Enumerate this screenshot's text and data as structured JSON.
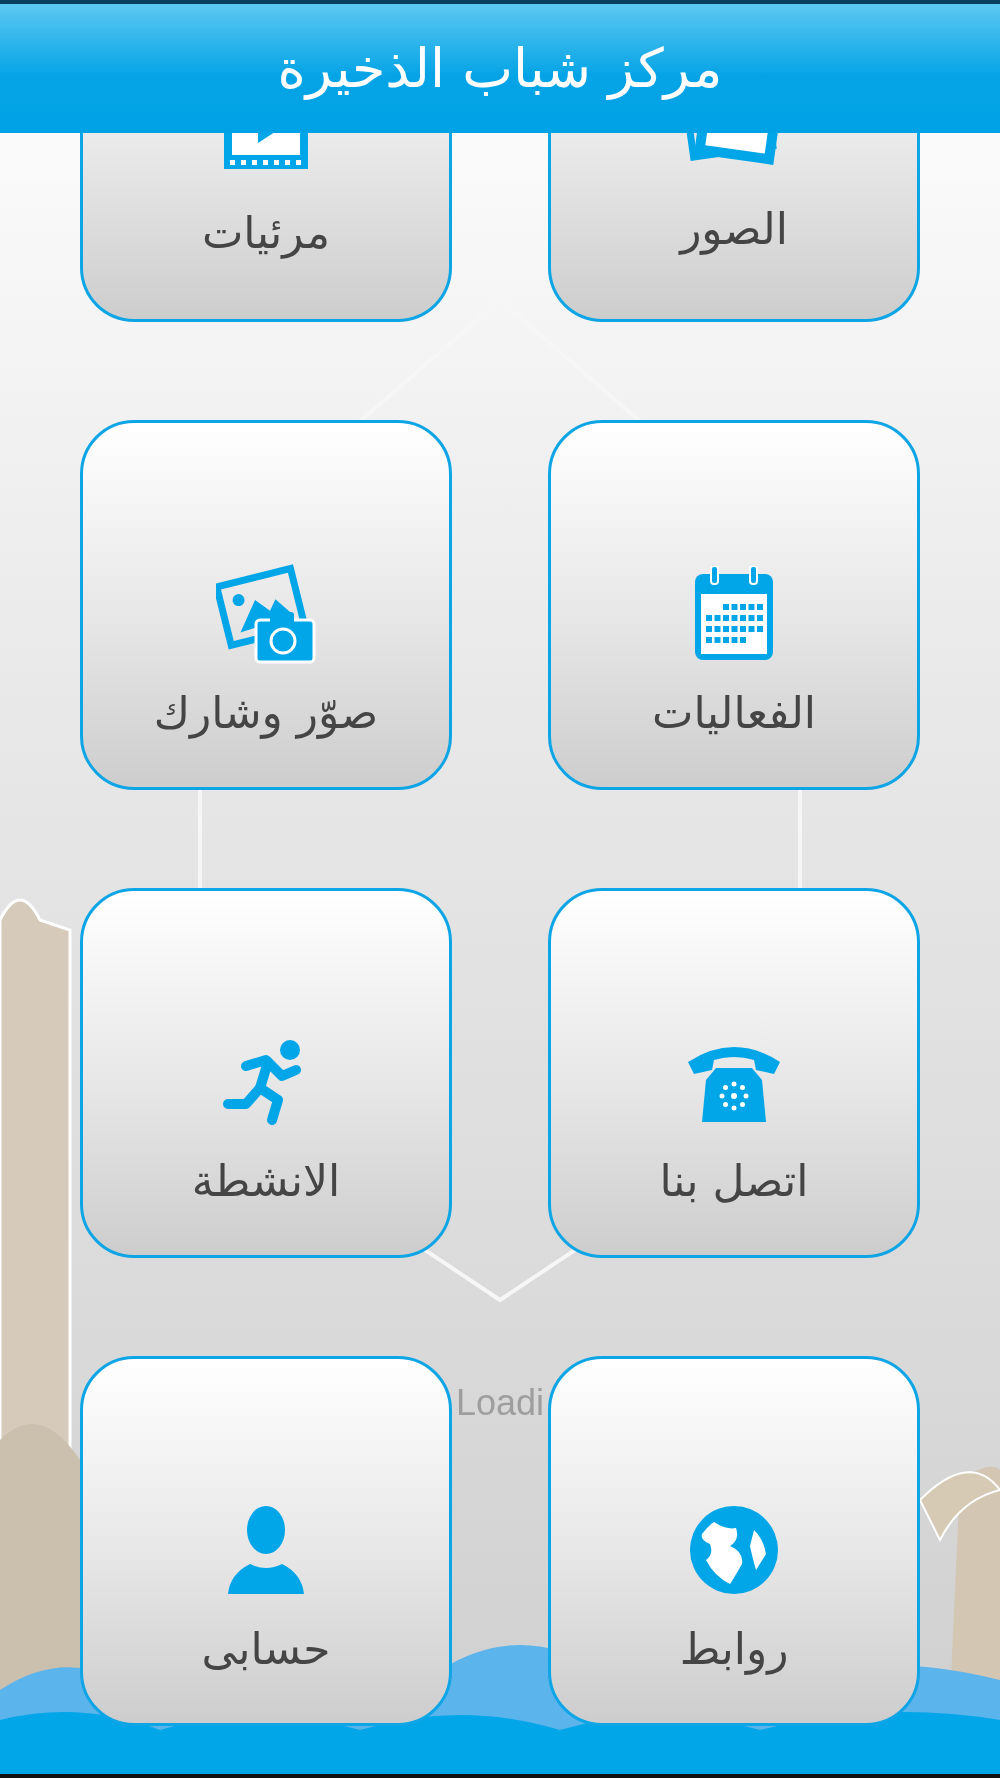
{
  "header": {
    "title": "مركز شباب الذخيرة"
  },
  "loading_text": "Loadi",
  "tiles": [
    {
      "label": "الصور"
    },
    {
      "label": "مرئيات"
    },
    {
      "label": "الفعاليات"
    },
    {
      "label": "صوّر وشارك"
    },
    {
      "label": "اتصل بنا"
    },
    {
      "label": "الانشطة"
    },
    {
      "label": "روابط"
    },
    {
      "label": "حسابى"
    }
  ]
}
